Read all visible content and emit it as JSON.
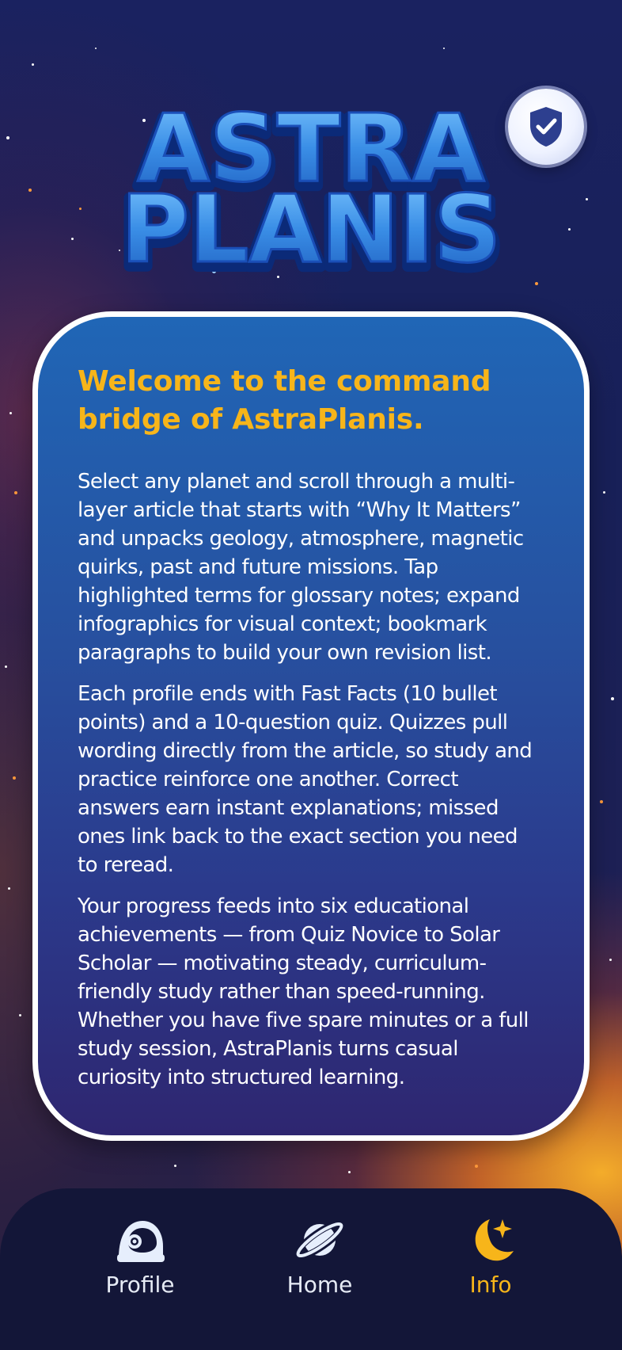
{
  "app": {
    "logo_line1": "ASTRA",
    "logo_line2": "PLANIS"
  },
  "header": {
    "privacy_icon": "shield-check-icon"
  },
  "card": {
    "title": "Welcome to the command bridge of AstraPlanis.",
    "paragraphs": [
      "Select any planet and scroll through a multi-layer article that starts with “Why It Matters” and unpacks geology, atmosphere, magnetic quirks, past and future missions. Tap highlighted terms for glossary notes; expand infographics for visual context; bookmark paragraphs to build your own revision list.",
      "Each profile ends with Fast Facts (10 bullet points) and a 10-question quiz. Quizzes pull wording directly from the article, so study and practice reinforce one another. Correct answers earn instant explanations; missed ones link back to the exact section you need to reread.",
      "Your progress feeds into six educational achievements — from Quiz Novice to Solar Scholar — motivating steady, curriculum-friendly study rather than speed-running. Whether you have five spare minutes or a full study session, AstraPlanis turns casual curiosity into structured learning."
    ]
  },
  "nav": {
    "items": [
      {
        "label": "Profile",
        "icon": "astronaut-helmet-icon",
        "active": false
      },
      {
        "label": "Home",
        "icon": "planet-icon",
        "active": false
      },
      {
        "label": "Info",
        "icon": "moon-star-icon",
        "active": true
      }
    ]
  },
  "colors": {
    "accent": "#f7b51a",
    "card_top": "#2066b6",
    "card_bottom": "#2e2670",
    "nav_bg": "#131638",
    "logo_blue": "#3a8ee6"
  }
}
